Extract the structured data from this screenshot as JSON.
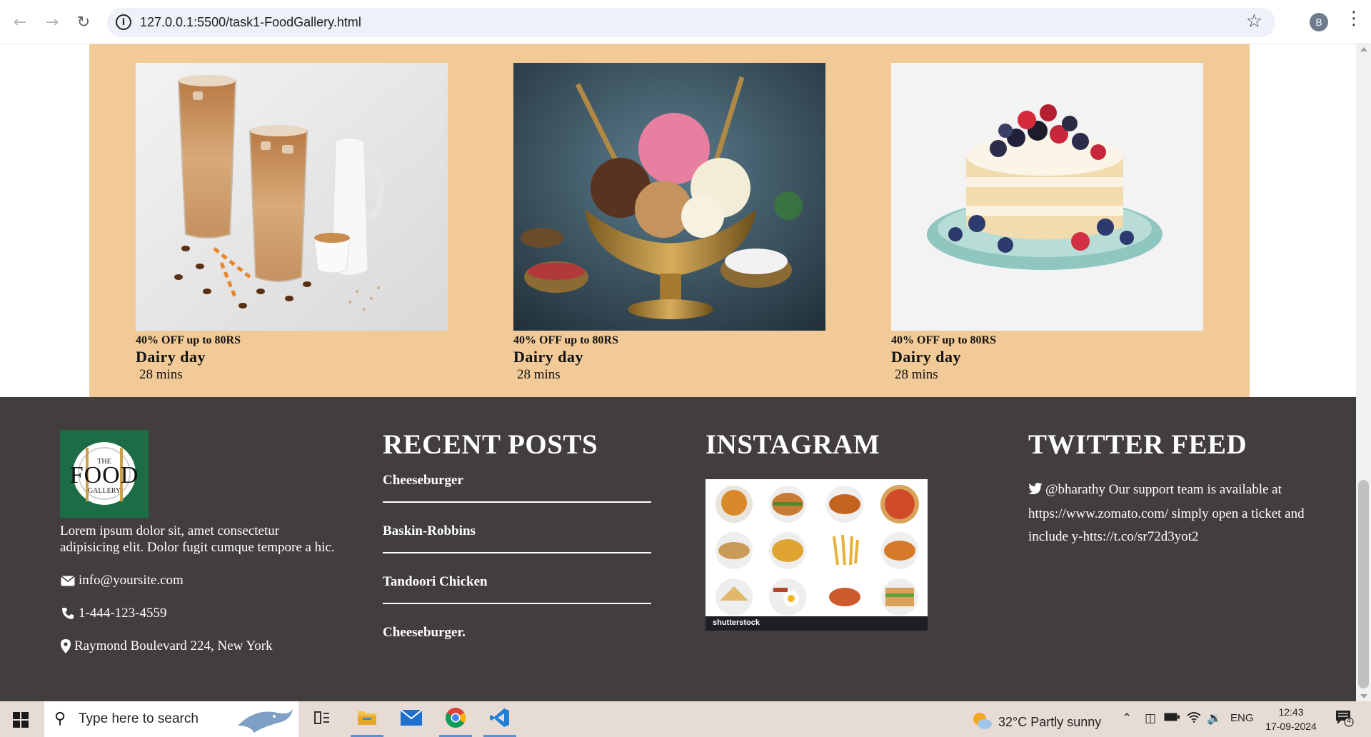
{
  "browser": {
    "url": "127.0.0.1:5500/task1-FoodGallery.html",
    "back_icon": "arrow-left-icon",
    "forward_icon": "arrow-right-icon",
    "reload_icon": "reload-icon",
    "profile_initial": "B"
  },
  "cards": [
    {
      "image": "iced-coffee-photo",
      "offer": "40% OFF up to 80RS",
      "title": "Dairy day",
      "time": "28 mins"
    },
    {
      "image": "ice-cream-bowl-photo",
      "offer": "40% OFF up to 80RS",
      "title": "Dairy day",
      "time": "28 mins"
    },
    {
      "image": "berry-cake-photo",
      "offer": "40% OFF up to 80RS",
      "title": "Dairy day",
      "time": "28 mins"
    }
  ],
  "footer": {
    "logo": {
      "top": "THE",
      "main": "FOOD",
      "bottom": "GALLERY"
    },
    "description": "Lorem ipsum dolor sit, amet consectetur adipisicing elit. Dolor fugit cumque tempore a hic.",
    "email": "info@yoursite.com",
    "phone": "1-444-123-4559",
    "address": "Raymond Boulevard 224, New York",
    "recent_posts": {
      "heading": "RECENT POSTS",
      "items": [
        "Cheeseburger",
        "Baskin-Robbins",
        "Tandoori Chicken",
        "Cheeseburger."
      ]
    },
    "instagram": {
      "heading": "INSTAGRAM",
      "image_brand": "shutterstock"
    },
    "twitter": {
      "heading": "TWITTER FEED",
      "tweet": "@bharathy Our support team is available at https://www.zomato.com/ simply open a ticket and include y-htts://t.co/sr72d3yot2"
    }
  },
  "taskbar": {
    "search_placeholder": "Type here to search",
    "weather": "32°C  Partly sunny",
    "language": "ENG",
    "time": "12:43",
    "date": "17-09-2024",
    "notification_count": "4"
  }
}
